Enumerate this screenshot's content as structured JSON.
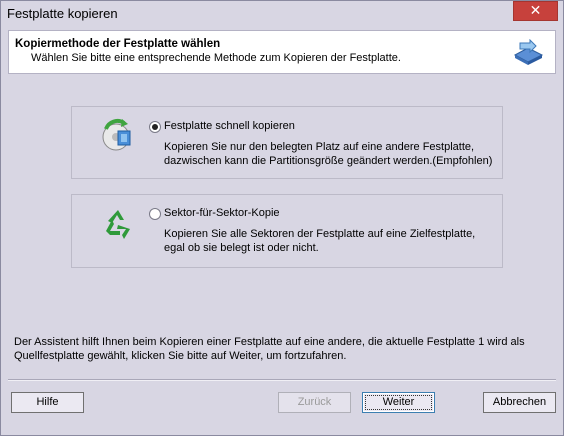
{
  "window": {
    "title": "Festplatte kopieren",
    "close_label": "✕"
  },
  "header": {
    "title": "Kopiermethode der Festplatte wählen",
    "subtitle": "Wählen Sie bitte eine entsprechende Methode zum Kopieren der Festplatte.",
    "icon": "disk-copy-icon"
  },
  "options": [
    {
      "label": "Festplatte schnell kopieren",
      "desc_line1": "Kopieren Sie nur den belegten Platz auf eine andere Festplatte,",
      "desc_line2": "dazwischen kann die Partitionsgröße geändert werden.(Empfohlen)",
      "selected": true,
      "icon": "fast-copy-icon"
    },
    {
      "label": "Sektor-für-Sektor-Kopie",
      "desc_line1": "Kopieren Sie alle Sektoren der Festplatte auf eine Zielfestplatte,",
      "desc_line2": "egal ob sie belegt ist oder nicht.",
      "selected": false,
      "icon": "recycle-icon"
    }
  ],
  "info": {
    "line1": "Der Assistent hilft Ihnen beim Kopieren einer Festplatte auf eine andere, die aktuelle Festplatte 1 wird als",
    "line2": "Quellfestplatte gewählt, klicken Sie bitte auf Weiter, um fortzufahren."
  },
  "buttons": {
    "help": "Hilfe",
    "back": "Zurück",
    "next": "Weiter",
    "cancel": "Abbrechen"
  }
}
